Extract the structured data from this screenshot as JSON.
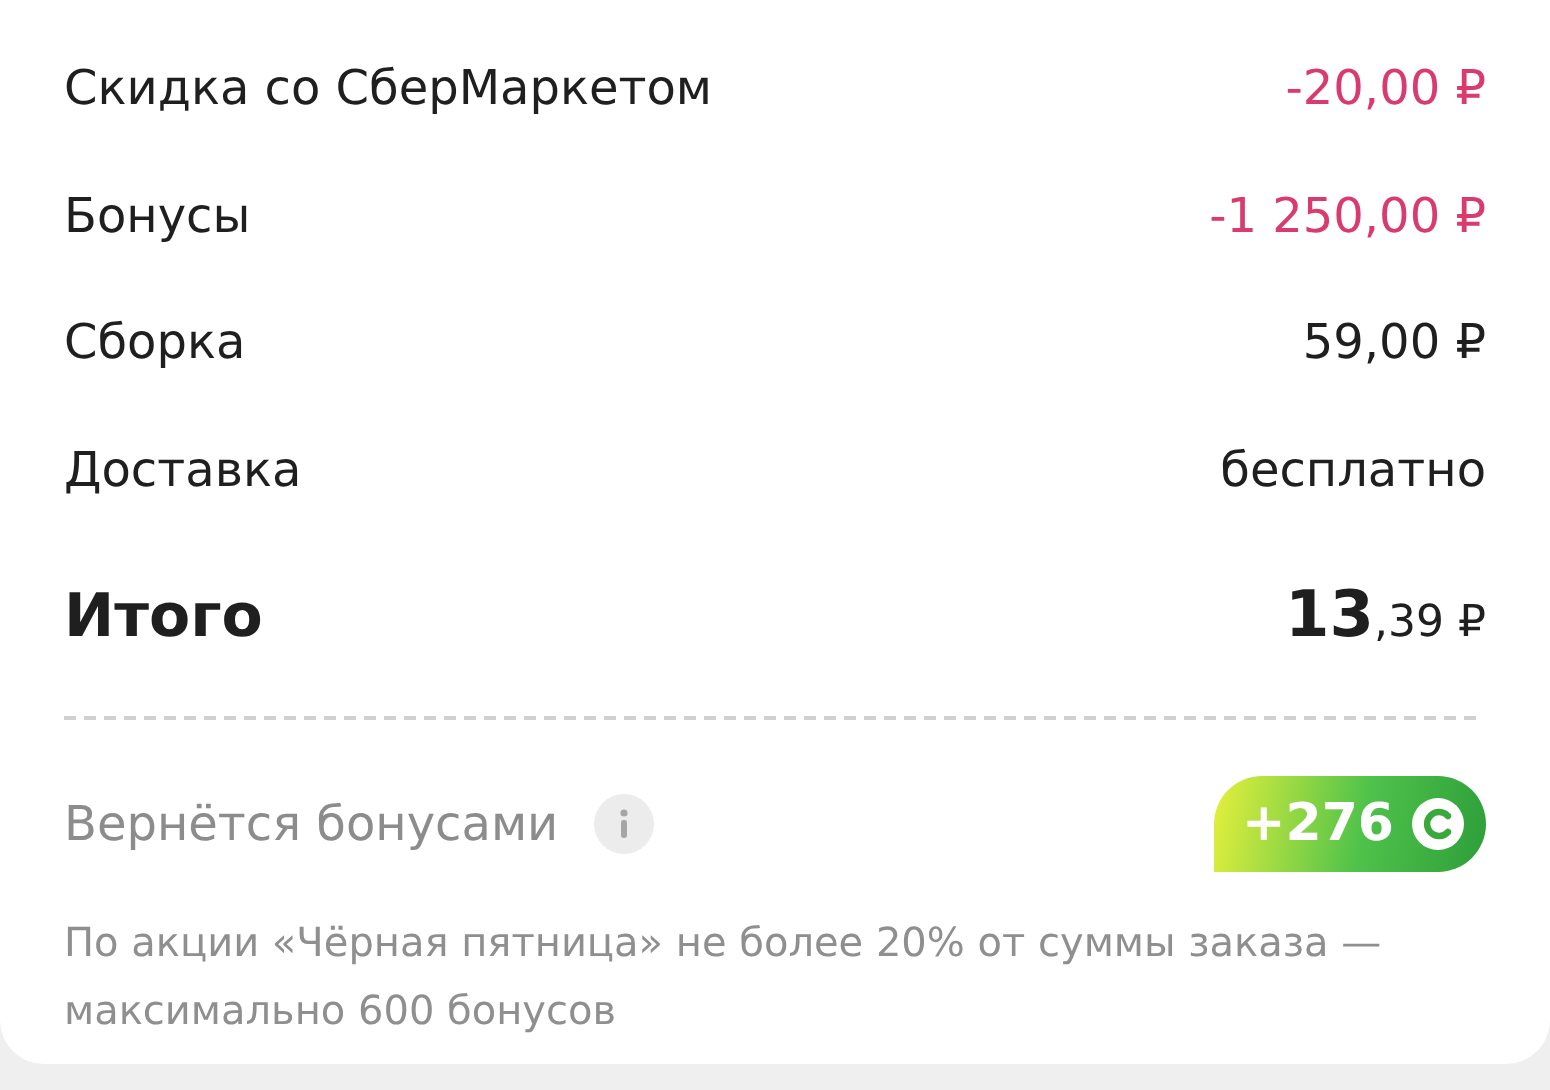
{
  "summary": [
    {
      "kind": "discount",
      "label": "Скидка со СберМаркетом",
      "amount": "-20,00 ₽"
    },
    {
      "kind": "discount",
      "label": "Бонусы",
      "amount": "-1 250,00 ₽"
    },
    {
      "kind": "charge",
      "label": "Сборка",
      "amount": "59,00 ₽"
    },
    {
      "kind": "charge",
      "label": "Доставка",
      "amount": "бесплатно"
    },
    {
      "kind": "total",
      "label": "Итого",
      "amount": "**13**,39 ₽"
    }
  ],
  "bonus": {
    "label": "Вернётся бонусами",
    "badge": "+276",
    "note": "По акции «Чёрная пятница» не более 20% от суммы заказа — максимально 600 бонусов"
  }
}
